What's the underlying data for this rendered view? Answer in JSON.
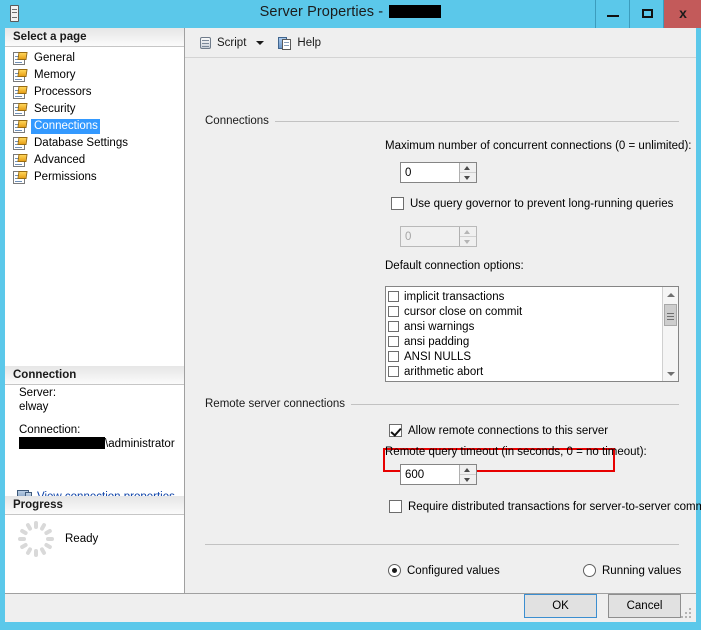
{
  "window": {
    "title_prefix": "Server Properties - ",
    "title_redacted": true,
    "icon": "server-properties-icon",
    "minimize_label": "",
    "maximize_label": "",
    "close_label": "x",
    "accent_color": "#5bc8ea",
    "close_button_color": "#c35a5a"
  },
  "sidebar": {
    "select_page_header": "Select a page",
    "pages": [
      {
        "label": "General",
        "selected": false
      },
      {
        "label": "Memory",
        "selected": false
      },
      {
        "label": "Processors",
        "selected": false
      },
      {
        "label": "Security",
        "selected": false
      },
      {
        "label": "Connections",
        "selected": true
      },
      {
        "label": "Database Settings",
        "selected": false
      },
      {
        "label": "Advanced",
        "selected": false
      },
      {
        "label": "Permissions",
        "selected": false
      }
    ],
    "selection_color": "#3399ff",
    "connection_header": "Connection",
    "server_label": "Server:",
    "server_value": "elway",
    "connection_label": "Connection:",
    "connection_value_suffix": "\\administrator",
    "connection_value_redacted": true,
    "view_connection_properties": "View connection properties",
    "link_color": "#0b41a8",
    "progress_header": "Progress",
    "progress_status": "Ready"
  },
  "toolbar": {
    "script_label": "Script",
    "help_label": "Help"
  },
  "connections_group": {
    "title": "Connections",
    "max_connections_label": "Maximum number of concurrent connections (0 = unlimited):",
    "max_connections_value": "0",
    "query_governor_label": "Use query governor to prevent long-running queries",
    "query_governor_checked": false,
    "query_governor_value": "0",
    "query_governor_enabled": false,
    "default_options_label": "Default connection options:",
    "default_options": [
      {
        "label": "implicit transactions",
        "checked": false
      },
      {
        "label": "cursor close on commit",
        "checked": false
      },
      {
        "label": "ansi warnings",
        "checked": false
      },
      {
        "label": "ansi padding",
        "checked": false
      },
      {
        "label": "ANSI NULLS",
        "checked": false
      },
      {
        "label": "arithmetic abort",
        "checked": false
      }
    ]
  },
  "remote_group": {
    "title": "Remote server connections",
    "allow_remote_label": "Allow remote connections to this server",
    "allow_remote_checked": true,
    "highlight_color": "#e70000",
    "remote_timeout_label": "Remote query timeout (in seconds, 0 = no timeout):",
    "remote_timeout_value": "600",
    "require_dtc_label": "Require distributed transactions for server-to-server communication",
    "require_dtc_checked": false
  },
  "values_mode": {
    "configured_label": "Configured values",
    "configured_selected": true,
    "running_label": "Running values",
    "running_selected": false
  },
  "footer": {
    "ok_label": "OK",
    "cancel_label": "Cancel"
  }
}
